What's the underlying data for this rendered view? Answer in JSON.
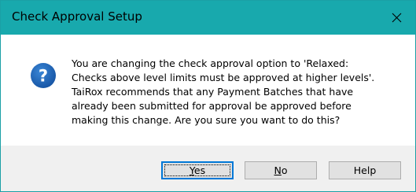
{
  "window": {
    "title": "Check Approval Setup",
    "close_glyph": "✕"
  },
  "message": {
    "lines": [
      "You are changing the check approval option to 'Relaxed:",
      "Checks above level limits must be approved at higher levels'.",
      "TaiRox recommends that any Payment Batches that have",
      "already been submitted for approval be approved before",
      "making this change. Are you sure you want to do this?"
    ]
  },
  "icon": {
    "name": "question-icon",
    "glyph": "?",
    "color": "#1a63b8"
  },
  "buttons": {
    "yes": {
      "mnemonic": "Y",
      "rest": "es"
    },
    "no": {
      "mnemonic": "N",
      "rest": "o"
    },
    "help": {
      "label": "Help"
    }
  },
  "colors": {
    "titlebar": "#18a9ad",
    "accent": "#0078d7"
  }
}
